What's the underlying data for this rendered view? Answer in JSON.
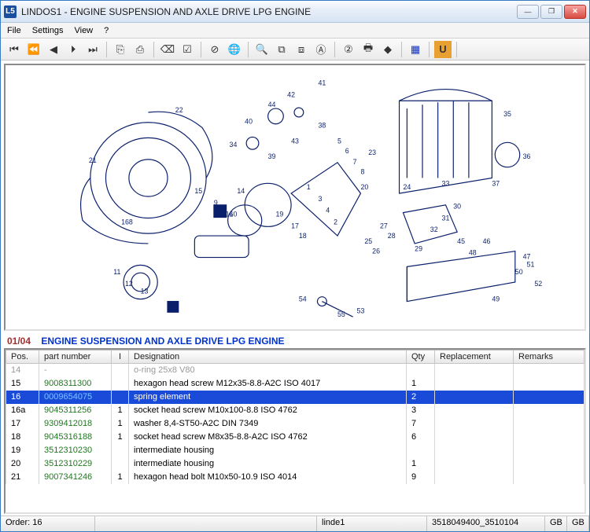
{
  "window": {
    "title": "LINDOS1 - ENGINE SUSPENSION AND AXLE DRIVE LPG ENGINE",
    "app_icon": "L5"
  },
  "menu": {
    "file": "File",
    "settings": "Settings",
    "view": "View",
    "help": "?"
  },
  "toolbar_icons": [
    "⏮",
    "⏪",
    "◀",
    "⏵",
    "⏭",
    "⎘",
    "⎙",
    "⌫",
    "☑",
    "⊘",
    "🌐",
    "🔍",
    "⧉",
    "⧈",
    "Ⓐ",
    "②",
    "🖶",
    "◆",
    "▦",
    "U"
  ],
  "section": {
    "code": "01/04",
    "title": "ENGINE SUSPENSION AND AXLE DRIVE LPG ENGINE"
  },
  "columns": {
    "pos": "Pos.",
    "part": "part number",
    "i": "I",
    "des": "Designation",
    "qty": "Qty",
    "repl": "Replacement",
    "rem": "Remarks"
  },
  "rows": [
    {
      "pos": "14",
      "part": "-",
      "i": "",
      "des": "o-ring 25x8 V80",
      "qty": "",
      "sel": false,
      "cut": true
    },
    {
      "pos": "15",
      "part": "9008311300",
      "i": "",
      "des": "hexagon head screw M12x35-8.8-A2C  ISO 4017",
      "qty": "1",
      "sel": false
    },
    {
      "pos": "16",
      "part": "0009654075",
      "i": "",
      "des": "spring element",
      "qty": "2",
      "sel": true
    },
    {
      "pos": "16a",
      "part": "9045311256",
      "i": "1",
      "des": "socket head screw M10x100-8.8  ISO 4762",
      "qty": "3",
      "sel": false
    },
    {
      "pos": "17",
      "part": "9309412018",
      "i": "1",
      "des": "washer 8,4-ST50-A2C  DIN 7349",
      "qty": "7",
      "sel": false
    },
    {
      "pos": "18",
      "part": "9045316188",
      "i": "1",
      "des": "socket head screw M8x35-8.8-A2C  ISO 4762",
      "qty": "6",
      "sel": false
    },
    {
      "pos": "19",
      "part": "3512310230",
      "i": "",
      "des": "intermediate housing",
      "qty": "",
      "sel": false
    },
    {
      "pos": "20",
      "part": "3512310229",
      "i": "",
      "des": "intermediate housing",
      "qty": "1",
      "sel": false
    },
    {
      "pos": "21",
      "part": "9007341246",
      "i": "1",
      "des": "hexagon head bolt M10x50-10.9  ISO 4014",
      "qty": "9",
      "sel": false
    }
  ],
  "status": {
    "order_label": "Order:",
    "order_val": "16",
    "user": "linde1",
    "code": "3518049400_3510104",
    "lang1": "GB",
    "lang2": "GB"
  },
  "callouts": [
    "41",
    "42",
    "44",
    "38",
    "22",
    "40",
    "43",
    "34",
    "39",
    "5",
    "6",
    "7",
    "8",
    "23",
    "35",
    "21",
    "1",
    "3",
    "4",
    "2",
    "14",
    "10",
    "17",
    "18",
    "20",
    "24",
    "37",
    "36",
    "168",
    "15",
    "9",
    "16",
    "19",
    "33",
    "27",
    "28",
    "25",
    "26",
    "31",
    "30",
    "11",
    "12",
    "13",
    "45",
    "48",
    "46",
    "29",
    "32",
    "47",
    "52",
    "50",
    "51",
    "49",
    "54",
    "55",
    "53"
  ]
}
